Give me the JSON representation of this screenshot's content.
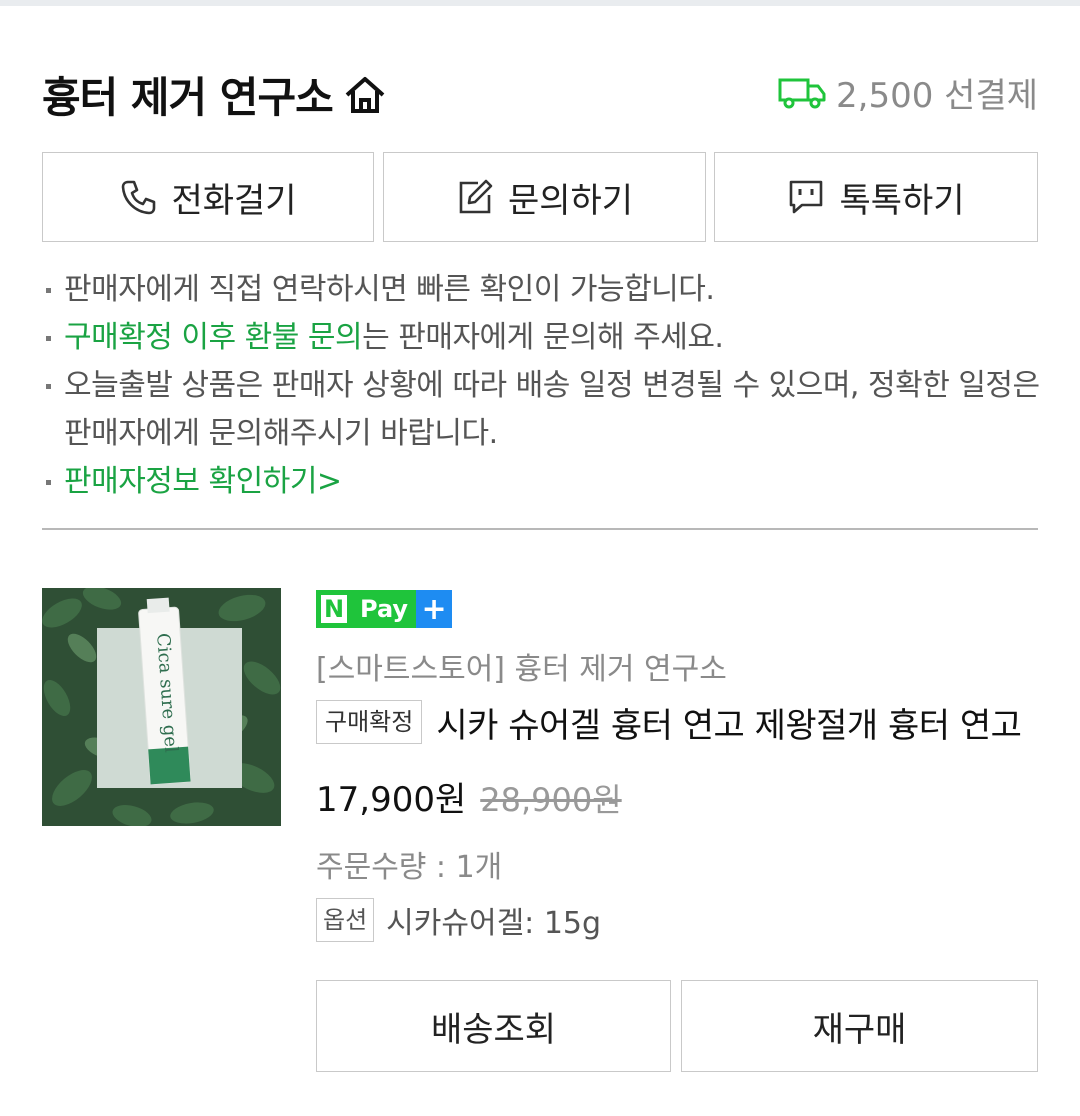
{
  "seller": {
    "name": "흉터 제거 연구소",
    "shipping_fee": "2,500 선결제",
    "icons": {
      "home": "home-icon",
      "shipping": "truck-icon"
    },
    "accent_color": "#1aa343"
  },
  "contact_buttons": [
    {
      "label": "전화걸기",
      "icon": "phone-icon"
    },
    {
      "label": "문의하기",
      "icon": "edit-icon"
    },
    {
      "label": "톡톡하기",
      "icon": "chat-icon"
    }
  ],
  "notes": {
    "note1": "판매자에게 직접 연락하시면 빠른 확인이 가능합니다.",
    "note2_highlight": "구매확정 이후 환불 문의",
    "note2_rest": "는 판매자에게 문의해 주세요.",
    "note3": "오늘출발 상품은 판매자 상황에 따라 배송 일정 변경될 수 있으며, 정확한 일정은 판매자에게 문의해주시기 바랍니다.",
    "seller_info_link": "판매자정보 확인하기>"
  },
  "product": {
    "image_text": "Cica sure gel",
    "npay": {
      "n": "N",
      "pay": "Pay",
      "plus": "+"
    },
    "store_label": "[스마트스토어] 흉터 제거 연구소",
    "status_badge": "구매확정",
    "title": "시카 슈어겔 흉터 연고 제왕절개 흉터 연고",
    "price": "17,900원",
    "original_price": "28,900원",
    "quantity": "주문수량 : 1개",
    "option_badge": "옵션",
    "option_value": "시카슈어겔: 15g"
  },
  "actions": {
    "track_delivery": "배송조회",
    "reorder": "재구매"
  }
}
